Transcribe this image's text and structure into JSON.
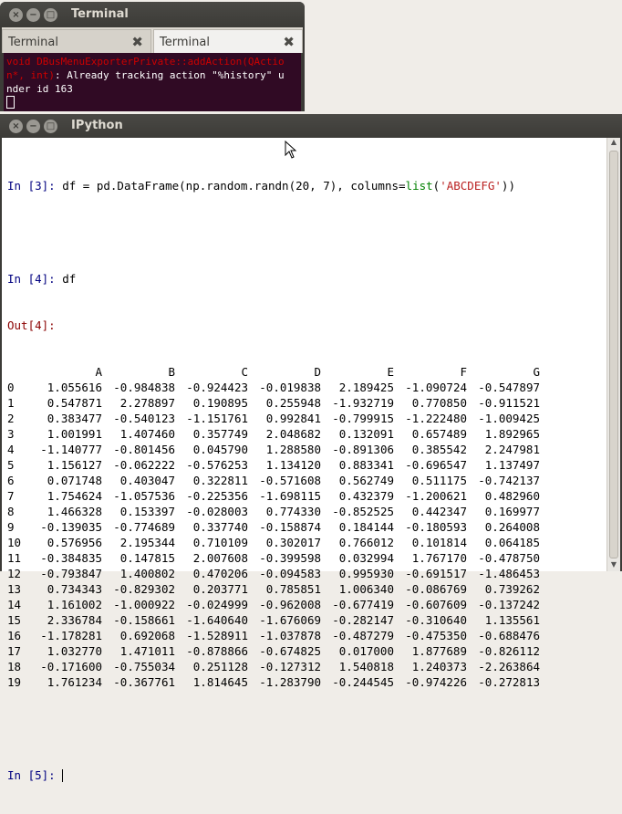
{
  "terminal": {
    "title": "Terminal",
    "tabs": [
      {
        "label": "Terminal"
      },
      {
        "label": "Terminal"
      }
    ],
    "lines": [
      {
        "err": "void DBusMenuExporterPrivate::addAction(QActio",
        "text": ""
      },
      {
        "err": "n*, int)",
        "text": ": Already tracking action \"%history\" u"
      },
      {
        "err": "",
        "text": "nder id 163"
      }
    ]
  },
  "ipython": {
    "title": "IPython",
    "in3": {
      "prompt_pre": "In [",
      "prompt_num": "3",
      "prompt_post": "]: ",
      "code_a": "df = pd.DataFrame(np.random.randn(",
      "n1": "20",
      "sep": ", ",
      "n2": "7",
      "code_b": "), columns=",
      "kw": "list",
      "paren": "(",
      "str": "'ABCDEFG'",
      "code_c": "))"
    },
    "in4": {
      "prompt_pre": "In [",
      "prompt_num": "4",
      "prompt_post": "]: ",
      "code": "df"
    },
    "out4": {
      "label": "Out[4]:"
    },
    "in5": {
      "prompt_pre": "In [",
      "prompt_num": "5",
      "prompt_post": "]: "
    },
    "dataframe": {
      "columns": [
        "A",
        "B",
        "C",
        "D",
        "E",
        "F",
        "G"
      ],
      "rows": [
        {
          "idx": "0",
          "vals": [
            "1.055616",
            "-0.984838",
            "-0.924423",
            "-0.019838",
            "2.189425",
            "-1.090724",
            "-0.547897"
          ]
        },
        {
          "idx": "1",
          "vals": [
            "0.547871",
            "2.278897",
            "0.190895",
            "0.255948",
            "-1.932719",
            "0.770850",
            "-0.911521"
          ]
        },
        {
          "idx": "2",
          "vals": [
            "0.383477",
            "-0.540123",
            "-1.151761",
            "0.992841",
            "-0.799915",
            "-1.222480",
            "-1.009425"
          ]
        },
        {
          "idx": "3",
          "vals": [
            "1.001991",
            "1.407460",
            "0.357749",
            "2.048682",
            "0.132091",
            "0.657489",
            "1.892965"
          ]
        },
        {
          "idx": "4",
          "vals": [
            "-1.140777",
            "-0.801456",
            "0.045790",
            "1.288580",
            "-0.891306",
            "0.385542",
            "2.247981"
          ]
        },
        {
          "idx": "5",
          "vals": [
            "1.156127",
            "-0.062222",
            "-0.576253",
            "1.134120",
            "0.883341",
            "-0.696547",
            "1.137497"
          ]
        },
        {
          "idx": "6",
          "vals": [
            "0.071748",
            "0.403047",
            "0.322811",
            "-0.571608",
            "0.562749",
            "0.511175",
            "-0.742137"
          ]
        },
        {
          "idx": "7",
          "vals": [
            "1.754624",
            "-1.057536",
            "-0.225356",
            "-1.698115",
            "0.432379",
            "-1.200621",
            "0.482960"
          ]
        },
        {
          "idx": "8",
          "vals": [
            "1.466328",
            "0.153397",
            "-0.028003",
            "0.774330",
            "-0.852525",
            "0.442347",
            "0.169977"
          ]
        },
        {
          "idx": "9",
          "vals": [
            "-0.139035",
            "-0.774689",
            "0.337740",
            "-0.158874",
            "0.184144",
            "-0.180593",
            "0.264008"
          ]
        },
        {
          "idx": "10",
          "vals": [
            "0.576956",
            "2.195344",
            "0.710109",
            "0.302017",
            "0.766012",
            "0.101814",
            "0.064185"
          ]
        },
        {
          "idx": "11",
          "vals": [
            "-0.384835",
            "0.147815",
            "2.007608",
            "-0.399598",
            "0.032994",
            "1.767170",
            "-0.478750"
          ]
        },
        {
          "idx": "12",
          "vals": [
            "-0.793847",
            "1.400802",
            "0.470206",
            "-0.094583",
            "0.995930",
            "-0.691517",
            "-1.486453"
          ]
        },
        {
          "idx": "13",
          "vals": [
            "0.734343",
            "-0.829302",
            "0.203771",
            "0.785851",
            "1.006340",
            "-0.086769",
            "0.739262"
          ]
        },
        {
          "idx": "14",
          "vals": [
            "1.161002",
            "-1.000922",
            "-0.024999",
            "-0.962008",
            "-0.677419",
            "-0.607609",
            "-0.137242"
          ]
        },
        {
          "idx": "15",
          "vals": [
            "2.336784",
            "-0.158661",
            "-1.640640",
            "-1.676069",
            "-0.282147",
            "-0.310640",
            "1.135561"
          ]
        },
        {
          "idx": "16",
          "vals": [
            "-1.178281",
            "0.692068",
            "-1.528911",
            "-1.037878",
            "-0.487279",
            "-0.475350",
            "-0.688476"
          ]
        },
        {
          "idx": "17",
          "vals": [
            "1.032770",
            "1.471011",
            "-0.878866",
            "-0.674825",
            "0.017000",
            "1.877689",
            "-0.826112"
          ]
        },
        {
          "idx": "18",
          "vals": [
            "-0.171600",
            "-0.755034",
            "0.251128",
            "-0.127312",
            "1.540818",
            "1.240373",
            "-2.263864"
          ]
        },
        {
          "idx": "19",
          "vals": [
            "1.761234",
            "-0.367761",
            "1.814645",
            "-1.283790",
            "-0.244545",
            "-0.974226",
            "-0.272813"
          ]
        }
      ]
    }
  },
  "window_buttons": {
    "close": "×",
    "min": "−",
    "max": "□"
  },
  "colors": {
    "terminal_bg": "#300a24",
    "titlebar": "#3c3b37",
    "prompt_in": "#000080",
    "prompt_out": "#8b0000",
    "string": "#ba2121",
    "keyword": "#008000"
  }
}
